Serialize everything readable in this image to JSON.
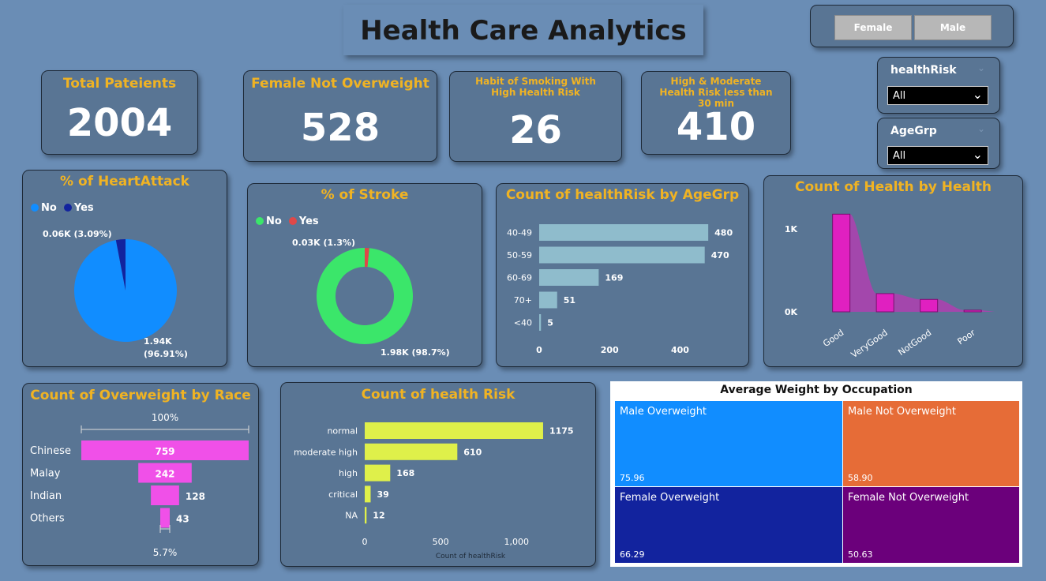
{
  "title": "Health Care Analytics",
  "gender_buttons": [
    "Female",
    "Male"
  ],
  "slicers": [
    {
      "label": "healthRisk",
      "value": "All"
    },
    {
      "label": "AgeGrp",
      "value": "All"
    }
  ],
  "kpis": [
    {
      "label": "Total Pateients",
      "value": "2004"
    },
    {
      "label": "Female Not Overweight",
      "value": "528"
    },
    {
      "label": "Habit of Smoking With High Health Risk",
      "value": "26"
    },
    {
      "label": "High & Moderate Health Risk less than 30 min",
      "value": "410"
    }
  ],
  "colors": {
    "background": "#6a8db5",
    "card": "#597594",
    "title_text": "#f0b323",
    "heart_no": "#118dff",
    "heart_yes": "#12239e",
    "stroke_no": "#3be66a",
    "stroke_yes": "#e04848",
    "agegrp_bar": "#8fbccc",
    "health_area": "#e020c0",
    "race_bar": "#f050e8",
    "risk_bar": "#dff04a"
  },
  "chart_data": [
    {
      "id": "heartattack",
      "type": "pie",
      "title": "% of HeartAttack",
      "legend": [
        "No",
        "Yes"
      ],
      "values": [
        1940,
        60
      ],
      "labels": [
        "1.94K (96.91%)",
        "0.06K (3.09%)"
      ]
    },
    {
      "id": "stroke",
      "type": "pie",
      "title": "% of Stroke",
      "legend": [
        "No",
        "Yes"
      ],
      "values": [
        1980,
        30
      ],
      "labels": [
        "1.98K (98.7%)",
        "0.03K (1.3%)"
      ]
    },
    {
      "id": "agegrp",
      "type": "bar",
      "title": "Count of healthRisk by AgeGrp",
      "categories": [
        "40-49",
        "50-59",
        "60-69",
        "70+",
        "<40"
      ],
      "values": [
        480,
        470,
        169,
        51,
        5
      ],
      "x_ticks": [
        "0",
        "200",
        "400"
      ],
      "xlim": [
        0,
        520
      ]
    },
    {
      "id": "health",
      "type": "area",
      "title": "Count of Health by Health",
      "categories": [
        "Good",
        "VeryGood",
        "NotGood",
        "Poor"
      ],
      "values": [
        1180,
        220,
        150,
        20
      ],
      "y_ticks": [
        "0K",
        "1K"
      ],
      "ylim": [
        0,
        1450
      ]
    },
    {
      "id": "race",
      "type": "bar",
      "title": "Count of Overweight by Race",
      "categories": [
        "Chinese",
        "Malay",
        "Indian",
        "Others"
      ],
      "values": [
        759,
        242,
        128,
        43
      ],
      "top_label": "100%",
      "bottom_label": "5.7%"
    },
    {
      "id": "risk",
      "type": "bar",
      "title": "Count of health Risk",
      "categories": [
        "normal",
        "moderate high",
        "high",
        "critical",
        "NA"
      ],
      "values": [
        1175,
        610,
        168,
        39,
        12
      ],
      "x_ticks": [
        "0",
        "500",
        "1,000"
      ],
      "xlabel": "Count of healthRisk",
      "xlim": [
        0,
        1300
      ]
    },
    {
      "id": "weight",
      "type": "table",
      "title": "Average Weight by Occupation",
      "cells": [
        {
          "name": "Male Overweight",
          "value": "75.96",
          "color": "#118dff"
        },
        {
          "name": "Male Not Overweight",
          "value": "58.90",
          "color": "#e66c37"
        },
        {
          "name": "Female Overweight",
          "value": "66.29",
          "color": "#12239e"
        },
        {
          "name": "Female Not Overweight",
          "value": "50.63",
          "color": "#6b007b"
        }
      ]
    }
  ]
}
